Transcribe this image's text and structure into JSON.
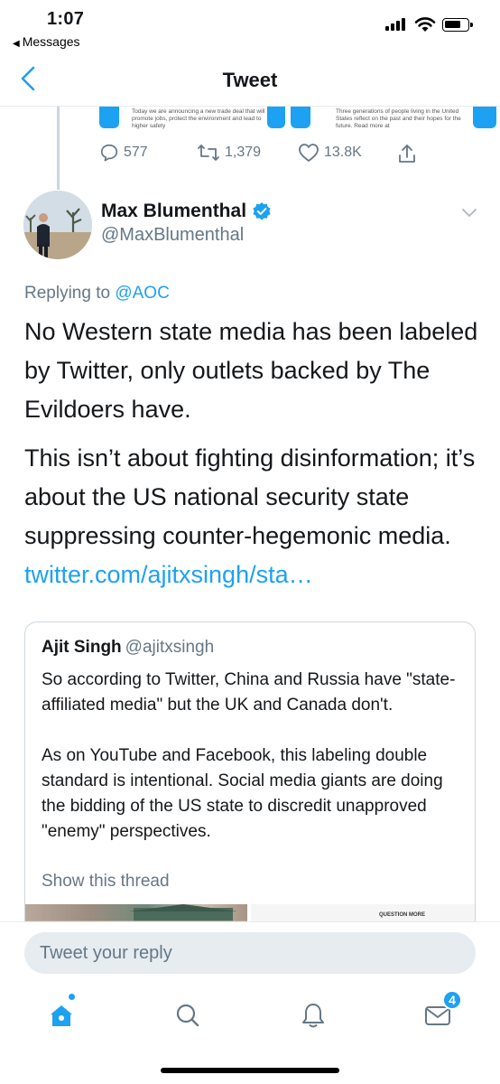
{
  "status_bar": {
    "time": "1:07",
    "back_app": "Messages"
  },
  "nav": {
    "title": "Tweet"
  },
  "previous_tweet": {
    "card_1_text": "Today we are announcing a new trade deal that will promote jobs, protect the environment and lead to higher safety",
    "card_2_text": "Three generations of people living in the United States reflect on the past and their hopes for the future. Read more at",
    "replies": "577",
    "retweets": "1,379",
    "likes": "13.8K"
  },
  "tweet": {
    "author_name": "Max Blumenthal",
    "author_handle": "@MaxBlumenthal",
    "verified": true,
    "replying_prefix": "Replying to",
    "replying_to": "@AOC",
    "paragraph_1": "No Western state media has been labeled by Twitter, only outlets backed by The Evildoers have.",
    "paragraph_2": "This isn’t about fighting disinformation; it’s about the US national security state suppressing counter-hegemonic media.",
    "link_text": "twitter.com/ajitxsingh/sta…"
  },
  "quote_tweet": {
    "name": "Ajit Singh",
    "handle": "@ajitxsingh",
    "paragraph_1": "So according to Twitter, China and Russia have \"state-affiliated media\" but the UK and Canada don't.",
    "paragraph_2": "As on YouTube and Facebook, this labeling double standard is intentional. Social media giants are doing the bidding of the US state to discredit unapproved \"enemy\" perspectives.",
    "show_thread": "Show this thread",
    "media_2_text": "QUESTION MORE"
  },
  "reply": {
    "placeholder": "Tweet your reply"
  },
  "tabbar": {
    "messages_badge": "4"
  },
  "colors": {
    "accent": "#1da1f2",
    "secondary_text": "#657786",
    "border": "#ccd6dd"
  }
}
